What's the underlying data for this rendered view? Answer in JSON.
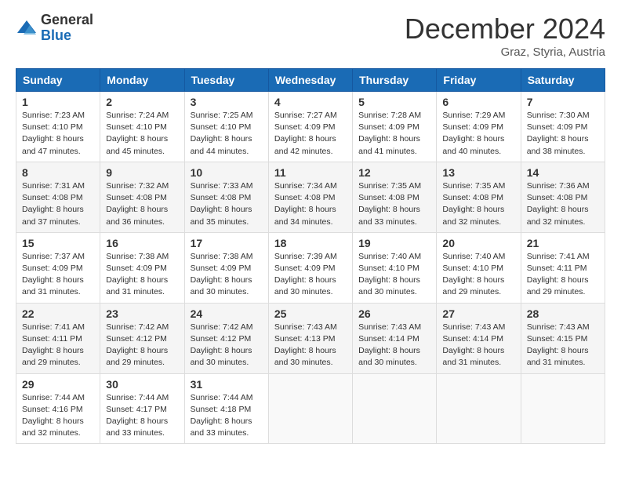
{
  "logo": {
    "general": "General",
    "blue": "Blue"
  },
  "title": "December 2024",
  "subtitle": "Graz, Styria, Austria",
  "weekdays": [
    "Sunday",
    "Monday",
    "Tuesday",
    "Wednesday",
    "Thursday",
    "Friday",
    "Saturday"
  ],
  "weeks": [
    [
      {
        "day": "1",
        "sunrise": "7:23 AM",
        "sunset": "4:10 PM",
        "daylight": "8 hours and 47 minutes."
      },
      {
        "day": "2",
        "sunrise": "7:24 AM",
        "sunset": "4:10 PM",
        "daylight": "8 hours and 45 minutes."
      },
      {
        "day": "3",
        "sunrise": "7:25 AM",
        "sunset": "4:10 PM",
        "daylight": "8 hours and 44 minutes."
      },
      {
        "day": "4",
        "sunrise": "7:27 AM",
        "sunset": "4:09 PM",
        "daylight": "8 hours and 42 minutes."
      },
      {
        "day": "5",
        "sunrise": "7:28 AM",
        "sunset": "4:09 PM",
        "daylight": "8 hours and 41 minutes."
      },
      {
        "day": "6",
        "sunrise": "7:29 AM",
        "sunset": "4:09 PM",
        "daylight": "8 hours and 40 minutes."
      },
      {
        "day": "7",
        "sunrise": "7:30 AM",
        "sunset": "4:09 PM",
        "daylight": "8 hours and 38 minutes."
      }
    ],
    [
      {
        "day": "8",
        "sunrise": "7:31 AM",
        "sunset": "4:08 PM",
        "daylight": "8 hours and 37 minutes."
      },
      {
        "day": "9",
        "sunrise": "7:32 AM",
        "sunset": "4:08 PM",
        "daylight": "8 hours and 36 minutes."
      },
      {
        "day": "10",
        "sunrise": "7:33 AM",
        "sunset": "4:08 PM",
        "daylight": "8 hours and 35 minutes."
      },
      {
        "day": "11",
        "sunrise": "7:34 AM",
        "sunset": "4:08 PM",
        "daylight": "8 hours and 34 minutes."
      },
      {
        "day": "12",
        "sunrise": "7:35 AM",
        "sunset": "4:08 PM",
        "daylight": "8 hours and 33 minutes."
      },
      {
        "day": "13",
        "sunrise": "7:35 AM",
        "sunset": "4:08 PM",
        "daylight": "8 hours and 32 minutes."
      },
      {
        "day": "14",
        "sunrise": "7:36 AM",
        "sunset": "4:08 PM",
        "daylight": "8 hours and 32 minutes."
      }
    ],
    [
      {
        "day": "15",
        "sunrise": "7:37 AM",
        "sunset": "4:09 PM",
        "daylight": "8 hours and 31 minutes."
      },
      {
        "day": "16",
        "sunrise": "7:38 AM",
        "sunset": "4:09 PM",
        "daylight": "8 hours and 31 minutes."
      },
      {
        "day": "17",
        "sunrise": "7:38 AM",
        "sunset": "4:09 PM",
        "daylight": "8 hours and 30 minutes."
      },
      {
        "day": "18",
        "sunrise": "7:39 AM",
        "sunset": "4:09 PM",
        "daylight": "8 hours and 30 minutes."
      },
      {
        "day": "19",
        "sunrise": "7:40 AM",
        "sunset": "4:10 PM",
        "daylight": "8 hours and 30 minutes."
      },
      {
        "day": "20",
        "sunrise": "7:40 AM",
        "sunset": "4:10 PM",
        "daylight": "8 hours and 29 minutes."
      },
      {
        "day": "21",
        "sunrise": "7:41 AM",
        "sunset": "4:11 PM",
        "daylight": "8 hours and 29 minutes."
      }
    ],
    [
      {
        "day": "22",
        "sunrise": "7:41 AM",
        "sunset": "4:11 PM",
        "daylight": "8 hours and 29 minutes."
      },
      {
        "day": "23",
        "sunrise": "7:42 AM",
        "sunset": "4:12 PM",
        "daylight": "8 hours and 29 minutes."
      },
      {
        "day": "24",
        "sunrise": "7:42 AM",
        "sunset": "4:12 PM",
        "daylight": "8 hours and 30 minutes."
      },
      {
        "day": "25",
        "sunrise": "7:43 AM",
        "sunset": "4:13 PM",
        "daylight": "8 hours and 30 minutes."
      },
      {
        "day": "26",
        "sunrise": "7:43 AM",
        "sunset": "4:14 PM",
        "daylight": "8 hours and 30 minutes."
      },
      {
        "day": "27",
        "sunrise": "7:43 AM",
        "sunset": "4:14 PM",
        "daylight": "8 hours and 31 minutes."
      },
      {
        "day": "28",
        "sunrise": "7:43 AM",
        "sunset": "4:15 PM",
        "daylight": "8 hours and 31 minutes."
      }
    ],
    [
      {
        "day": "29",
        "sunrise": "7:44 AM",
        "sunset": "4:16 PM",
        "daylight": "8 hours and 32 minutes."
      },
      {
        "day": "30",
        "sunrise": "7:44 AM",
        "sunset": "4:17 PM",
        "daylight": "8 hours and 33 minutes."
      },
      {
        "day": "31",
        "sunrise": "7:44 AM",
        "sunset": "4:18 PM",
        "daylight": "8 hours and 33 minutes."
      },
      null,
      null,
      null,
      null
    ]
  ]
}
